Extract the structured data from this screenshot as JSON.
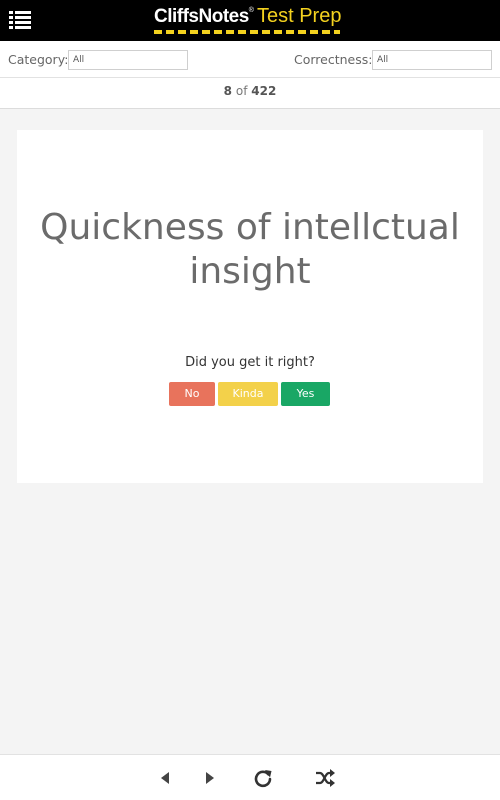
{
  "header": {
    "brand_name": "CliffsNotes",
    "brand_reg": "®",
    "brand_suffix": "Test Prep",
    "menu_icon": "hamburger-menu-icon"
  },
  "filters": {
    "category_label": "Category:",
    "category_value": "All",
    "correctness_label": "Correctness:",
    "correctness_value": "All"
  },
  "counter": {
    "current": "8",
    "separator": "of",
    "total": "422"
  },
  "card": {
    "term": "Quickness of intellctual insight"
  },
  "feedback": {
    "prompt": "Did you get it right?",
    "no_label": "No",
    "kinda_label": "Kinda",
    "yes_label": "Yes"
  },
  "colors": {
    "no": "#e8735c",
    "kinda": "#f3d14a",
    "yes": "#19a765",
    "brand_accent": "#f4d21f"
  },
  "bottom_nav": {
    "icons": [
      "previous-icon",
      "next-icon",
      "reload-icon",
      "shuffle-icon"
    ]
  }
}
